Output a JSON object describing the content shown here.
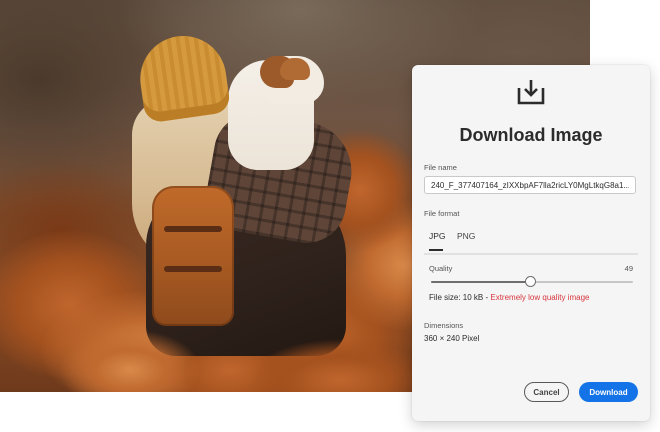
{
  "dialog": {
    "title": "Download Image",
    "file_name_label": "File name",
    "file_name_value": "240_F_377407164_zIXXbpAF7lla2ricLY0MgLtkqG8a1...",
    "file_format_label": "File format",
    "format_tabs": [
      {
        "label": "JPG",
        "selected": true
      },
      {
        "label": "PNG",
        "selected": false
      }
    ],
    "quality_label": "Quality",
    "quality_value": "49",
    "quality_fraction": 0.49,
    "file_size_text": "File size: 10 kB - ",
    "file_size_warning": "Extremely low quality image",
    "dimensions_label": "Dimensions",
    "dimensions_value": "360 × 240 Pixel",
    "cancel_label": "Cancel",
    "download_label": "Download"
  },
  "colors": {
    "accent": "#1473e6",
    "warning": "#d7373f",
    "panel_background": "#f5f5f5"
  },
  "icons": {
    "header_icon": "download-icon"
  }
}
